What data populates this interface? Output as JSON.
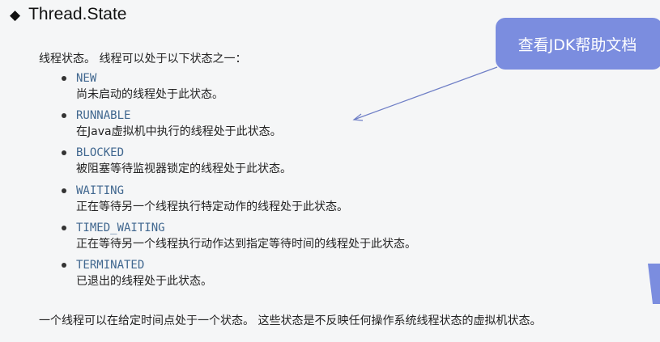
{
  "heading": {
    "bullet_icon": "diamond-icon",
    "title": "Thread.State"
  },
  "callout": {
    "label": "查看JDK帮助文档",
    "color": "#7b8ddf"
  },
  "intro": "线程状态。 线程可以处于以下状态之一：",
  "states": [
    {
      "name": "NEW",
      "desc": "尚未启动的线程处于此状态。"
    },
    {
      "name": "RUNNABLE",
      "desc": "在Java虚拟机中执行的线程处于此状态。"
    },
    {
      "name": "BLOCKED",
      "desc": "被阻塞等待监视器锁定的线程处于此状态。"
    },
    {
      "name": "WAITING",
      "desc": "正在等待另一个线程执行特定动作的线程处于此状态。"
    },
    {
      "name": "TIMED_WAITING",
      "desc": "正在等待另一个线程执行动作达到指定等待时间的线程处于此状态。"
    },
    {
      "name": "TERMINATED",
      "desc": "已退出的线程处于此状态。"
    }
  ],
  "summary": "一个线程可以在给定时间点处于一个状态。 这些状态是不反映任何操作系统线程状态的虚拟机状态。",
  "colors": {
    "state_name": "#40678f",
    "background": "#f5f6f7"
  }
}
